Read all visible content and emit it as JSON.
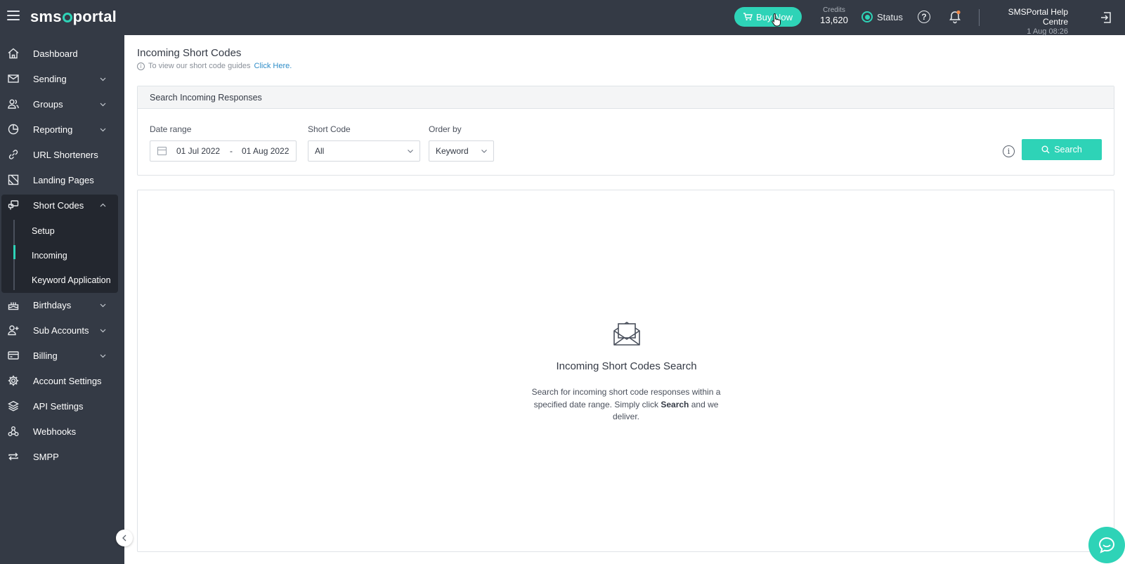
{
  "app": {
    "logo": "smsportal",
    "buy_now": "Buy Now",
    "credits_label": "Credits",
    "credits_value": "13,620",
    "status_label": "Status",
    "user_name": "SMSPortal Help Centre",
    "user_datetime": "1 Aug 08:26",
    "accent_color": "#2ed3b7",
    "header_bg": "#343a45"
  },
  "sidebar": {
    "items": [
      {
        "label": "Dashboard",
        "icon": "home-icon"
      },
      {
        "label": "Sending",
        "icon": "envelope-icon",
        "expandable": true
      },
      {
        "label": "Groups",
        "icon": "users-icon",
        "expandable": true
      },
      {
        "label": "Reporting",
        "icon": "pie-chart-icon",
        "expandable": true
      },
      {
        "label": "URL Shorteners",
        "icon": "link-icon"
      },
      {
        "label": "Landing Pages",
        "icon": "landing-page-icon"
      },
      {
        "label": "Short Codes",
        "icon": "short-codes-icon",
        "expandable": true,
        "expanded": true
      },
      {
        "label": "Birthdays",
        "icon": "cake-icon",
        "expandable": true
      },
      {
        "label": "Sub Accounts",
        "icon": "user-plus-icon",
        "expandable": true
      },
      {
        "label": "Billing",
        "icon": "credit-card-icon",
        "expandable": true
      },
      {
        "label": "Account Settings",
        "icon": "gear-icon"
      },
      {
        "label": "API Settings",
        "icon": "layers-icon"
      },
      {
        "label": "Webhooks",
        "icon": "webhook-icon"
      },
      {
        "label": "SMPP",
        "icon": "repeat-icon"
      }
    ],
    "short_codes_children": [
      {
        "label": "Setup"
      },
      {
        "label": "Incoming",
        "active": true
      },
      {
        "label": "Keyword Application"
      }
    ]
  },
  "page": {
    "title": "Incoming Short Codes",
    "guide_text": "To view our short code guides",
    "guide_link": "Click Here."
  },
  "search": {
    "header": "Search Incoming Responses",
    "date_range_label": "Date range",
    "date_from": "01 Jul 2022",
    "date_separator": "-",
    "date_to": "01 Aug 2022",
    "short_code_label": "Short Code",
    "short_code_value": "All",
    "order_by_label": "Order by",
    "order_by_value": "Keyword",
    "button": "Search"
  },
  "empty_state": {
    "title": "Incoming Short Codes Search",
    "desc_part1": "Search for incoming short code responses within a specified date range. Simply click",
    "desc_bold": "Search",
    "desc_part2": "and we deliver."
  }
}
